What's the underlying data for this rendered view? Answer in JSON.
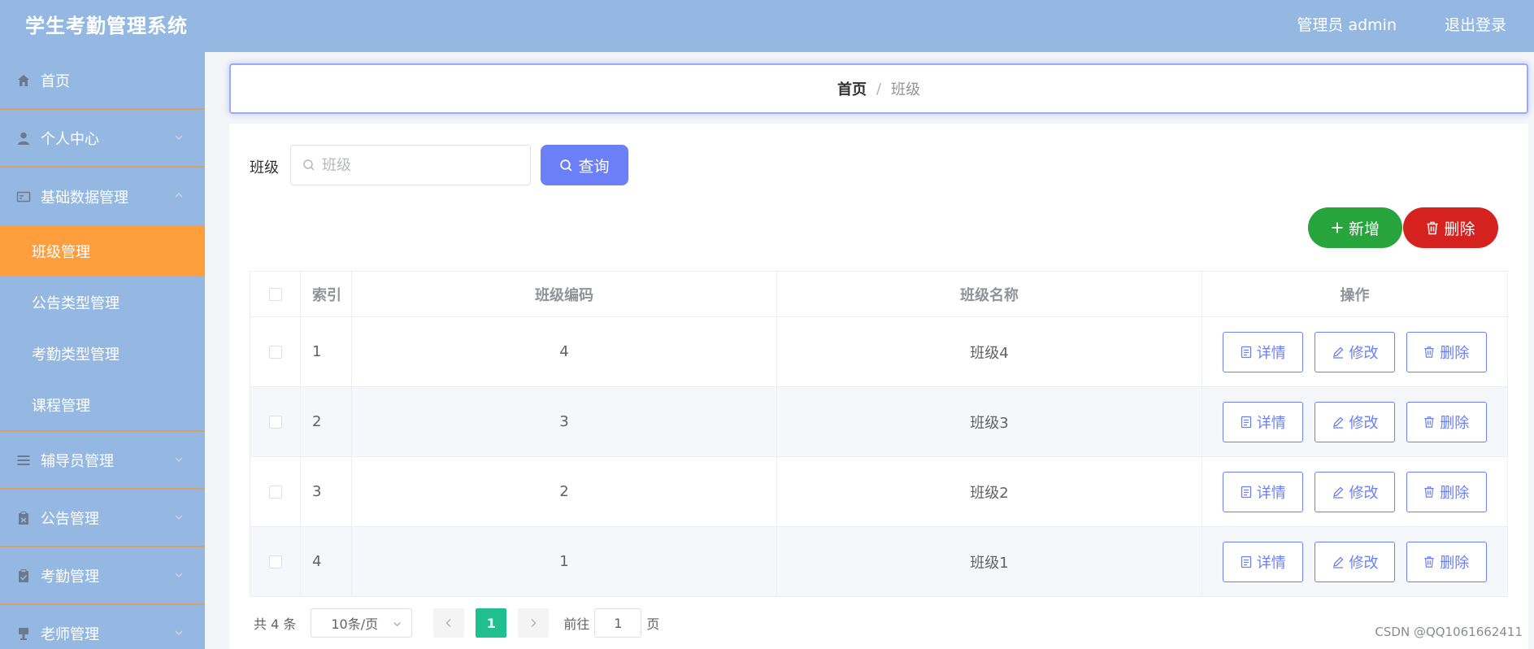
{
  "header": {
    "title": "学生考勤管理系统",
    "admin_label": "管理员 admin",
    "logout_label": "退出登录"
  },
  "sidebar": {
    "items": [
      {
        "label": "首页",
        "icon": "home-icon"
      },
      {
        "label": "个人中心",
        "icon": "user-icon"
      },
      {
        "label": "基础数据管理",
        "icon": "card-icon"
      },
      {
        "label": "辅导员管理",
        "icon": "list-icon"
      },
      {
        "label": "公告管理",
        "icon": "clipboard-icon"
      },
      {
        "label": "考勤管理",
        "icon": "check-clipboard-icon"
      },
      {
        "label": "老师管理",
        "icon": "stamp-icon"
      }
    ],
    "subitems": [
      {
        "label": "班级管理",
        "active": true
      },
      {
        "label": "公告类型管理",
        "active": false
      },
      {
        "label": "考勤类型管理",
        "active": false
      },
      {
        "label": "课程管理",
        "active": false
      }
    ]
  },
  "breadcrumb": {
    "home": "首页",
    "separator": "/",
    "current": "班级"
  },
  "search": {
    "label": "班级",
    "placeholder": "班级",
    "button_label": "查询"
  },
  "actions": {
    "add_label": "新增",
    "delete_label": "删除"
  },
  "table": {
    "headers": {
      "index": "索引",
      "code": "班级编码",
      "name": "班级名称",
      "ops": "操作"
    },
    "op_labels": {
      "detail": "详情",
      "edit": "修改",
      "delete": "删除"
    },
    "rows": [
      {
        "index": "1",
        "code": "4",
        "name": "班级4"
      },
      {
        "index": "2",
        "code": "3",
        "name": "班级3"
      },
      {
        "index": "3",
        "code": "2",
        "name": "班级2"
      },
      {
        "index": "4",
        "code": "1",
        "name": "班级1"
      }
    ]
  },
  "pagination": {
    "total": "共 4 条",
    "page_size": "10条/页",
    "current_page": "1",
    "goto_label": "前往",
    "goto_value": "1",
    "page_suffix": "页"
  },
  "watermark": "CSDN @QQ1061662411",
  "colors": {
    "header_bg": "#95b8e3",
    "active_menu": "#ff9e3d",
    "primary": "#6b7ff7",
    "add_green": "#27a53c",
    "delete_red": "#d6221f",
    "page_active": "#1fbf8f"
  }
}
